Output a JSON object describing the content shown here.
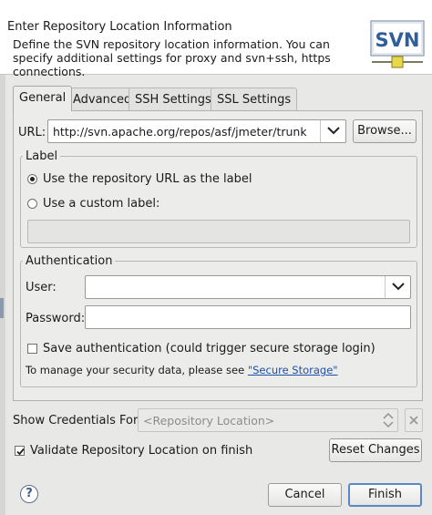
{
  "header": {
    "title": "Enter Repository Location Information",
    "description": "Define the SVN repository location information. You can specify additional settings for proxy and svn+ssh, https connections.",
    "logo_text": "SVN"
  },
  "tabs": [
    {
      "label": "General",
      "active": true
    },
    {
      "label": "Advanced",
      "active": false
    },
    {
      "label": "SSH Settings",
      "active": false
    },
    {
      "label": "SSL Settings",
      "active": false
    }
  ],
  "url": {
    "label": "URL:",
    "value": "http://svn.apache.org/repos/asf/jmeter/trunk",
    "browse_label": "Browse..."
  },
  "label_group": {
    "title": "Label",
    "option_repo_url": "Use the repository URL as the label",
    "option_custom": "Use a custom label:",
    "custom_value": ""
  },
  "auth_group": {
    "title": "Authentication",
    "user_label": "User:",
    "user_value": "",
    "password_label": "Password:",
    "password_value": "",
    "save_auth_label": "Save authentication (could trigger secure storage login)",
    "security_text": "To manage your security data, please see ",
    "secure_storage_link": "\"Secure Storage\""
  },
  "credentials": {
    "label": "Show Credentials For:",
    "placeholder": "<Repository Location>"
  },
  "validate_label": "Validate Repository Location on finish",
  "reset_label": "Reset Changes",
  "footer": {
    "help": "?",
    "cancel_label": "Cancel",
    "finish_label": "Finish"
  },
  "colors": {
    "logo_blue": "#2f5e9c",
    "link": "#1f4fa8",
    "default_button_border": "#5a88c6"
  }
}
